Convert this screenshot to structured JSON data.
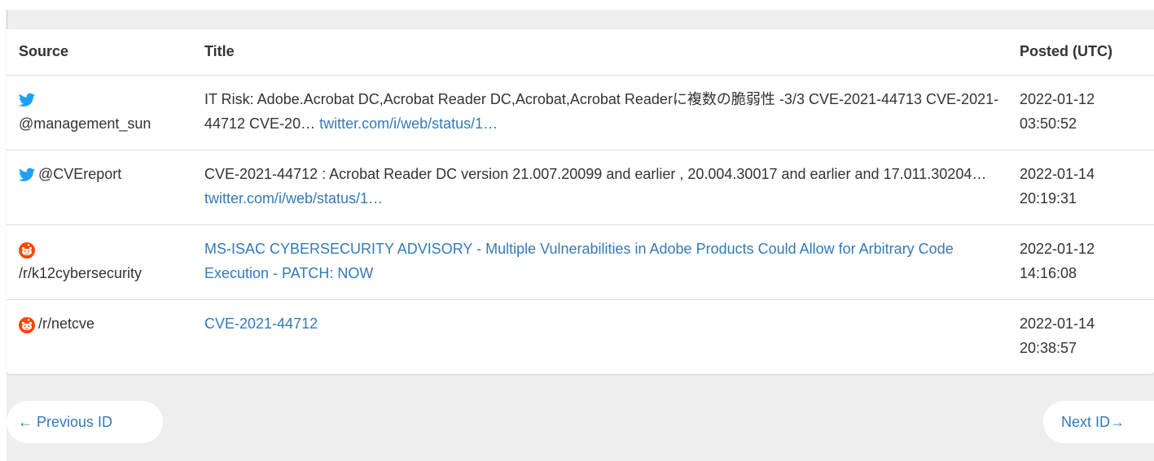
{
  "table": {
    "headers": {
      "source": "Source",
      "title": "Title",
      "posted": "Posted (UTC)"
    },
    "rows": [
      {
        "source_type": "twitter-icon",
        "source": "@management_sun",
        "title_text": "IT Risk: Adobe.Acrobat DC,Acrobat Reader DC,Acrobat,Acrobat Readerに複数の脆弱性 -3/3 CVE-2021-44713 CVE-2021-44712 CVE-20…",
        "title_link": "twitter.com/i/web/status/1…",
        "date": "2022-01-12",
        "time": "03:50:52"
      },
      {
        "source_type": "twitter-icon",
        "source": "@CVEreport",
        "title_text": "CVE-2021-44712 : Acrobat Reader DC version 21.007.20099 and earlier , 20.004.30017 and earlier and 17.011.30204…",
        "title_link": "twitter.com/i/web/status/1…",
        "date": "2022-01-14",
        "time": "20:19:31"
      },
      {
        "source_type": "reddit-icon",
        "source": "/r/k12cybersecurity",
        "title_text": "",
        "title_link": "MS-ISAC CYBERSECURITY ADVISORY - Multiple Vulnerabilities in Adobe Products Could Allow for Arbitrary Code Execution - PATCH: NOW",
        "date": "2022-01-12",
        "time": "14:16:08"
      },
      {
        "source_type": "reddit-icon",
        "source": "/r/netcve",
        "title_text": "",
        "title_link": "CVE-2021-44712",
        "date": "2022-01-14",
        "time": "20:38:57"
      }
    ]
  },
  "pager": {
    "prev_label": "← Previous ID",
    "next_label": "Next ID→"
  },
  "colors": {
    "link": "#337ab7",
    "twitter": "#1da1f2",
    "reddit": "#ff4500",
    "background": "#eeeeee"
  }
}
